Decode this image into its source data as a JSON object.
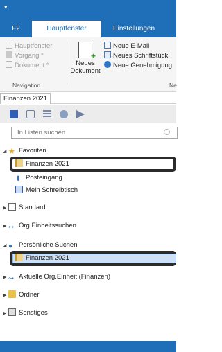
{
  "titlebar": {
    "quick_access": "▾"
  },
  "tabs": [
    {
      "label": "F2"
    },
    {
      "label": "Hauptfenster"
    },
    {
      "label": "Einstellungen"
    }
  ],
  "ribbon": {
    "nav_items": [
      {
        "label": "Hauptfenster"
      },
      {
        "label": "Vorgang *"
      },
      {
        "label": "Dokument *"
      }
    ],
    "new_document": "Neues Dokument",
    "new_items": [
      {
        "label": "Neue E-Mail"
      },
      {
        "label": "Neues Schriftstück"
      },
      {
        "label": "Neue Genehmigung"
      }
    ],
    "group_navigation": "Navigation",
    "group_new": "Ne"
  },
  "doc_tab": "Finanzen 2021",
  "search": {
    "placeholder": "In Listen suchen"
  },
  "tree": {
    "favoriten": "Favoriten",
    "finanzen_fav": "Finanzen 2021",
    "posteingang": "Posteingang",
    "schreibtisch": "Mein Schreibtisch",
    "standard": "Standard",
    "org_suchen": "Org.Einheitssuchen",
    "persoenliche": "Persönliche Suchen",
    "finanzen_pers": "Finanzen 2021",
    "aktuelle_org": "Aktuelle Org.Einheit (Finanzen)",
    "ordner": "Ordner",
    "sonstiges": "Sonstiges"
  },
  "colors": {
    "accent": "#1f6fb8",
    "selection": "#cde0f5",
    "highlight_frame": "#2b2b2b"
  }
}
